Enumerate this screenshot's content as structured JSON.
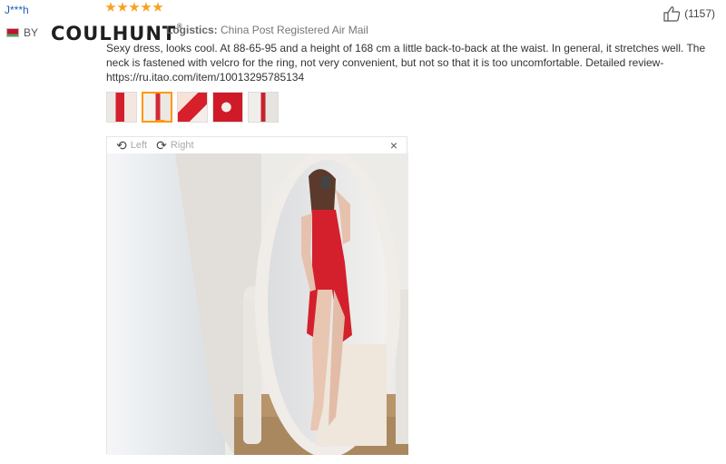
{
  "review": {
    "username": "J***h",
    "country_code": "BY",
    "rating": 5,
    "watermark": "COULHUNT",
    "watermark_mark": "®",
    "watermark_suffix": "l",
    "logistics_label": "Logistics:",
    "logistics_value": "China Post Registered Air Mail",
    "helpful_count": "(1157)",
    "text": "Sexy dress, looks cool. At 88-65-95 and a height of 168 cm a little back-to-back at the waist. In general, it stretches well. The neck is fastened with velcro for the ring, not very convenient, but not so that it is too uncomfortable. Detailed review- https://ru.itao.com/item/10013295785134"
  },
  "viewer": {
    "left_label": "Left",
    "right_label": "Right",
    "close_glyph": "×",
    "rotate_left_icon": "rotate-left-icon",
    "rotate_right_icon": "rotate-right-icon"
  },
  "colors": {
    "star": "#f8a121",
    "accent": "#ff9900",
    "username": "#1a5fb4",
    "dress": "#d3202c"
  },
  "thumbnails": {
    "count": 5,
    "active_index": 1
  }
}
